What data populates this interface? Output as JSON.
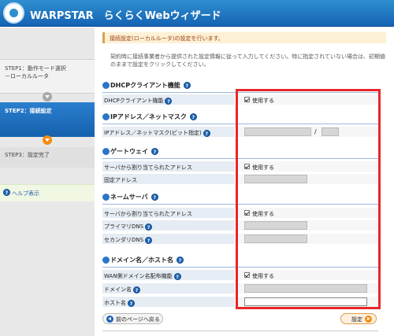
{
  "header": {
    "title": "WARPSTAR　らくらくWebウィザード"
  },
  "sidebar": {
    "step1_label": "STEP1：動作モード選択",
    "step1_sub": "－ローカルルータ",
    "step2_label": "STEP2：接続設定",
    "step3_label": "STEP3：設定完了",
    "help_label": "ヘルプ表示"
  },
  "main": {
    "notice": "接続設定(ローカルルータ)の設定を行います。",
    "info": "契約時に接続事業者から提供された設定情報に従って入力してください。特に指定されていない場合は、初期値のままで設定をクリックしてください。"
  },
  "sections": {
    "dhcp": {
      "title": "DHCPクライアント機能",
      "row_label": "DHCPクライアント機能",
      "check_label": "使用する"
    },
    "ip": {
      "title": "IPアドレス／ネットマスク",
      "row_label": "IPアドレス／ネットマスク(ビット指定)",
      "separator": "/"
    },
    "gateway": {
      "title": "ゲートウェイ",
      "row1_label": "サーバから割り当てられたアドレス",
      "row1_check": "使用する",
      "row2_label": "固定アドレス"
    },
    "dns": {
      "title": "ネームサーバ",
      "row1_label": "サーバから割り当てられたアドレス",
      "row1_check": "使用する",
      "row2_label": "プライマリDNS",
      "row3_label": "セカンダリDNS"
    },
    "domain": {
      "title": "ドメイン名／ホスト名",
      "row1_label": "WAN側ドメイン名配布機能",
      "row1_check": "使用する",
      "row2_label": "ドメイン名",
      "row3_label": "ホスト名"
    }
  },
  "buttons": {
    "back": "前のページへ戻る",
    "set": "設定"
  },
  "colors": {
    "header": "#1f74c2",
    "active_step": "#1f6fbf",
    "highlight": "#e8262a",
    "accent_orange": "#f28c13"
  }
}
